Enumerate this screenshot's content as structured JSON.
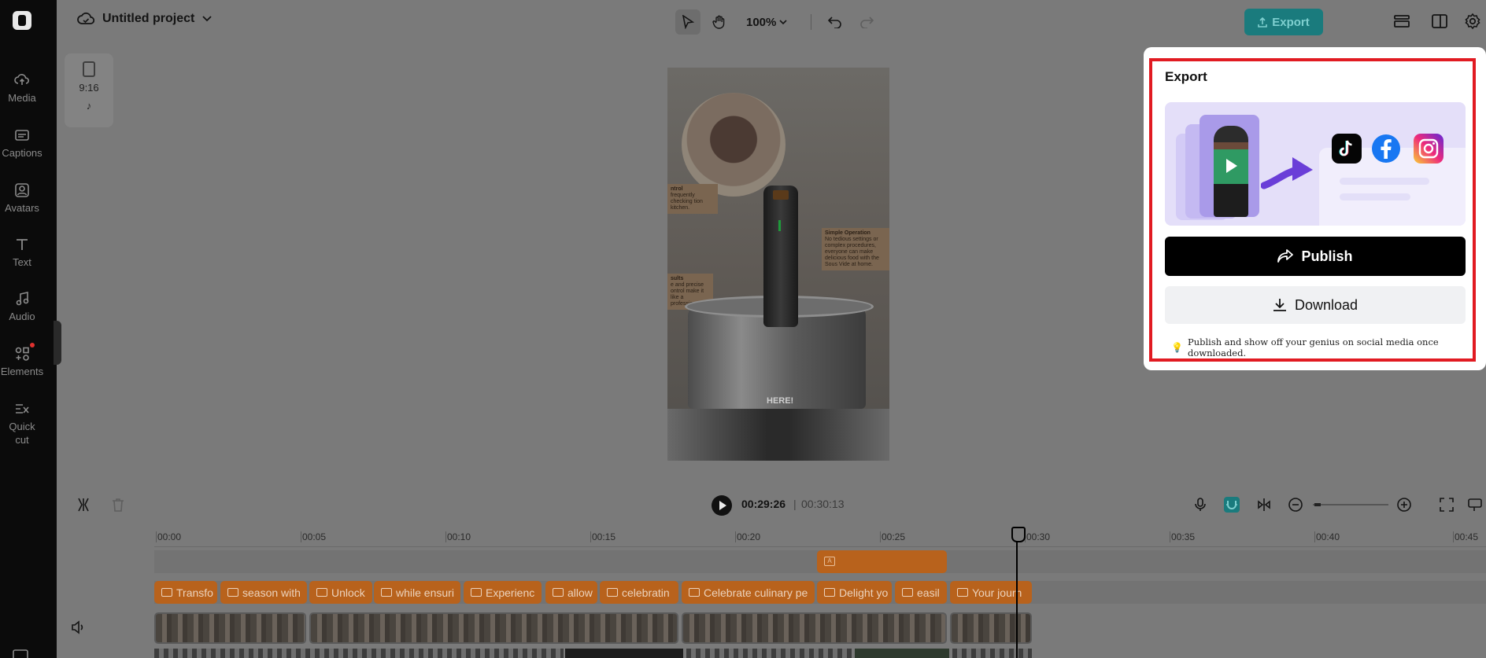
{
  "project": {
    "title": "Untitled project"
  },
  "toolbar": {
    "zoom": "100%",
    "export_label": "Export"
  },
  "sidebar": {
    "items": [
      {
        "label": "Media",
        "icon": "cloud-upload-icon"
      },
      {
        "label": "Captions",
        "icon": "captions-icon"
      },
      {
        "label": "Avatars",
        "icon": "avatar-icon"
      },
      {
        "label": "Text",
        "icon": "text-icon"
      },
      {
        "label": "Audio",
        "icon": "music-note-icon"
      },
      {
        "label": "Elements",
        "icon": "elements-icon"
      },
      {
        "label": "Quick cut",
        "icon": "quick-cut-icon"
      }
    ]
  },
  "canvas": {
    "aspect_ratio": "9:16",
    "callouts": [
      {
        "title": "ntrol",
        "body": "frequently checking tion kitchen."
      },
      {
        "title": "Simple Operation",
        "body": "No tedious settings or complex procedures, everyone can make delicious food with the Sous Vide at home."
      },
      {
        "title": "sults",
        "body": "e and precise ontrol make it like a professional."
      }
    ],
    "overlay_text": "HERE!"
  },
  "export_panel": {
    "title": "Export",
    "publish_label": "Publish",
    "download_label": "Download",
    "tip": "Publish and show off your genius on social media once downloaded.",
    "social_icons": [
      "tiktok-icon",
      "facebook-icon",
      "instagram-icon"
    ]
  },
  "playback": {
    "current": "00:29:26",
    "separator": "|",
    "total": "00:30:13"
  },
  "timeline": {
    "ruler": [
      "00:00",
      "00:05",
      "00:10",
      "00:15",
      "00:20",
      "00:25",
      "00:30",
      "00:35",
      "00:40",
      "00:45"
    ],
    "captions": [
      "Transfo",
      "season with",
      "Unlock",
      "while ensuri",
      "Experienc",
      "allow",
      "celebratin",
      "Celebrate culinary pe",
      "Delight yo",
      "easil",
      "Your journ"
    ]
  },
  "colors": {
    "accent": "#1a7b7d",
    "clip": "#b8621c",
    "highlight": "#e11b22"
  }
}
